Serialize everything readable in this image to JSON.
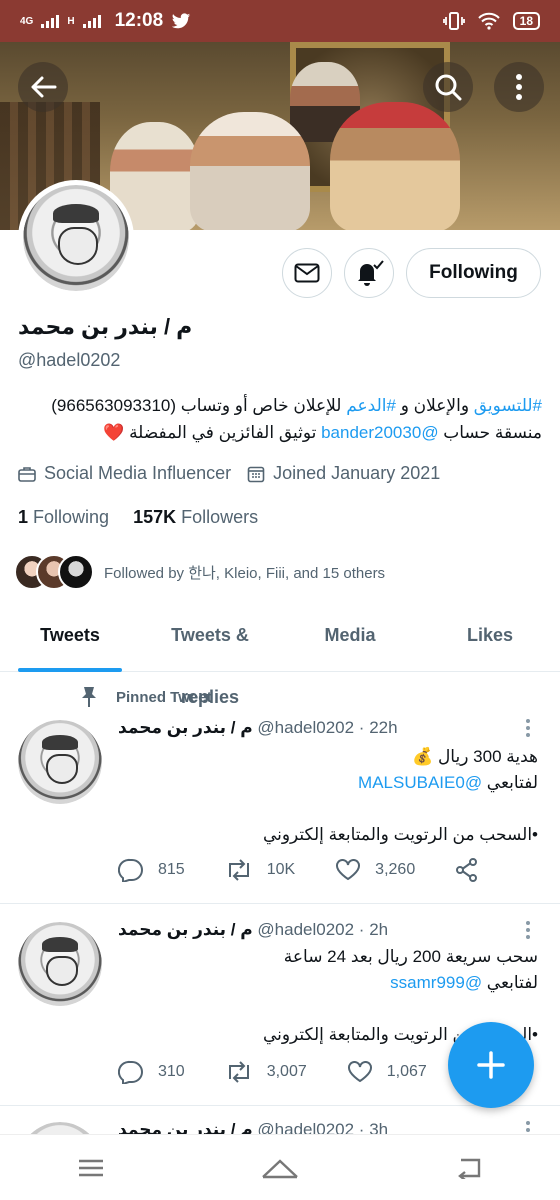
{
  "status_bar": {
    "network_top": "4G",
    "network_bottom": "H",
    "time": "12:08",
    "battery": "18",
    "icons": [
      "signal-icon",
      "twitter-bird-icon",
      "vibrate-icon",
      "wifi-icon",
      "battery-icon"
    ]
  },
  "colors": {
    "status_bar": "#8b3a32",
    "accent": "#1d9bf0",
    "text": "#0f1419",
    "muted": "#536471",
    "heart": "#e0245e"
  },
  "profile": {
    "name": "م / بندر بن محمد",
    "handle": "@hadel0202",
    "bio_line1_link1": "#للتسويق",
    "bio_line1_text1": " والإعلان و ",
    "bio_line1_link2": "#الدعم",
    "bio_line1_text2": " للإعلان خاص أو وتساب (966563093310)",
    "bio_line2_text1": "منسقة حساب ",
    "bio_line2_link": "@bander20030",
    "bio_line2_text2": " توثيق الفائزين في المفضلة ",
    "bio_heart": "❤️",
    "category": "Social Media Influencer",
    "joined": "Joined January 2021",
    "following_count": "1",
    "following_label": "Following",
    "followers_count": "157K",
    "followers_label": "Followers",
    "followed_by": "Followed by 한나, Kleio, Fiii, and 15 others",
    "following_button": "Following"
  },
  "tabs": [
    {
      "label": "Tweets",
      "active": true
    },
    {
      "label": "Tweets & replies",
      "active": false
    },
    {
      "label": "Media",
      "active": false
    },
    {
      "label": "Likes",
      "active": false
    }
  ],
  "tweets": [
    {
      "pinned_label": "Pinned Tweet",
      "author": "م / بندر بن محمد",
      "handle_time": " @hadel0202 · 22h",
      "line1": "هدية 300 ريال 💰",
      "line2_text": "لفتابعي ",
      "line2_link": "@MALSUBAIE0",
      "line3": "•السحب من الرتويت والمتابعة إلكتروني",
      "replies": "815",
      "retweets": "10K",
      "likes": "3,260"
    },
    {
      "author": "م / بندر بن محمد",
      "handle_time": " @hadel0202 · 2h",
      "line1": "سحب سريعة 200 ريال بعد 24 ساعة",
      "line2_text": "لفتابعي ",
      "line2_link": "@ssamr999",
      "line3": "•السحب من الرتويت والمتابعة إلكتروني",
      "replies": "310",
      "retweets": "3,007",
      "likes": "1,067"
    },
    {
      "author": "م / بندر بن محمد",
      "handle_time": " @hadel0202 · 3h"
    }
  ]
}
